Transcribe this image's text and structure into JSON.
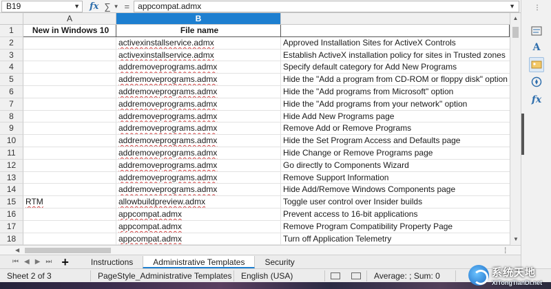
{
  "formula_bar": {
    "namebox": "B19",
    "formula": "appcompat.admx",
    "fx_label": "fx",
    "sum_label": "∑",
    "equals_label": "="
  },
  "columns": [
    "A",
    "B"
  ],
  "rows": [
    {
      "n": "1",
      "a": "New in Windows 10",
      "b": "File name",
      "c": ""
    },
    {
      "n": "2",
      "a": "",
      "b": "activexinstallservice.admx",
      "c": "Approved Installation Sites for ActiveX Controls"
    },
    {
      "n": "3",
      "a": "",
      "b": "activexinstallservice.admx",
      "c": "Establish ActiveX installation policy for sites in Trusted zones"
    },
    {
      "n": "4",
      "a": "",
      "b": "addremoveprograms.admx",
      "c": "Specify default category for Add New Programs"
    },
    {
      "n": "5",
      "a": "",
      "b": "addremoveprograms.admx",
      "c": "Hide the \"Add a program from CD-ROM or floppy disk\" option"
    },
    {
      "n": "6",
      "a": "",
      "b": "addremoveprograms.admx",
      "c": "Hide the \"Add programs from Microsoft\" option"
    },
    {
      "n": "7",
      "a": "",
      "b": "addremoveprograms.admx",
      "c": "Hide the \"Add programs from your network\" option"
    },
    {
      "n": "8",
      "a": "",
      "b": "addremoveprograms.admx",
      "c": "Hide Add New Programs page"
    },
    {
      "n": "9",
      "a": "",
      "b": "addremoveprograms.admx",
      "c": "Remove Add or Remove Programs"
    },
    {
      "n": "10",
      "a": "",
      "b": "addremoveprograms.admx",
      "c": "Hide the Set Program Access and Defaults page"
    },
    {
      "n": "11",
      "a": "",
      "b": "addremoveprograms.admx",
      "c": "Hide Change or Remove Programs page"
    },
    {
      "n": "12",
      "a": "",
      "b": "addremoveprograms.admx",
      "c": "Go directly to Components Wizard"
    },
    {
      "n": "13",
      "a": "",
      "b": "addremoveprograms.admx",
      "c": "Remove Support Information"
    },
    {
      "n": "14",
      "a": "",
      "b": "addremoveprograms.admx",
      "c": "Hide Add/Remove Windows Components page"
    },
    {
      "n": "15",
      "a": "RTM",
      "b": "allowbuildpreview.admx",
      "c": "Toggle user control over Insider builds"
    },
    {
      "n": "16",
      "a": "",
      "b": "appcompat.admx",
      "c": "Prevent access to 16-bit applications"
    },
    {
      "n": "17",
      "a": "",
      "b": "appcompat.admx",
      "c": "Remove Program Compatibility Property Page"
    },
    {
      "n": "18",
      "a": "",
      "b": "appcompat.admx",
      "c": "Turn off Application Telemetry"
    }
  ],
  "tabs": {
    "add": "+",
    "items": [
      "Instructions",
      "Administrative Templates",
      "Security"
    ],
    "active": "Administrative Templates"
  },
  "status": {
    "sheet": "Sheet 2 of 3",
    "page_style": "PageStyle_Administrative Templates",
    "language": "English (USA)",
    "summary": "Average: ; Sum: 0"
  },
  "sidebar_icons": [
    "properties-icon",
    "styles-icon",
    "gallery-icon",
    "navigator-icon",
    "functions-icon"
  ],
  "watermark": {
    "title": "系统天地",
    "url": "XiTongTianDi.net"
  },
  "colors": {
    "accent": "#1d7fd0",
    "spell_underline": "#d04040"
  }
}
